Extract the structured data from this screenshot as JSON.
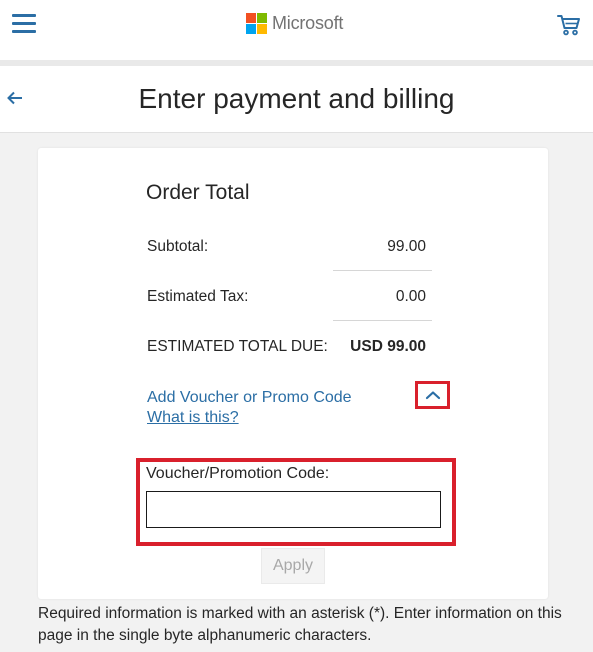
{
  "brand": {
    "name": "Microsoft",
    "logo_colors": [
      "#f25022",
      "#7fba00",
      "#00a4ef",
      "#ffb900"
    ]
  },
  "header": {
    "menu_icon": "hamburger-menu-icon",
    "cart_icon": "shopping-cart-icon"
  },
  "page": {
    "title": "Enter payment and billing",
    "back_icon": "back-arrow-icon"
  },
  "order": {
    "heading": "Order Total",
    "subtotal_label": "Subtotal:",
    "subtotal_value": "99.00",
    "tax_label": "Estimated Tax:",
    "tax_value": "0.00",
    "total_label": "ESTIMATED TOTAL DUE:",
    "total_value": "USD 99.00"
  },
  "voucher": {
    "toggle_label": "Add Voucher or Promo Code",
    "help_link": "What is this?",
    "toggle_icon": "chevron-up-icon",
    "field_label": "Voucher/Promotion Code:",
    "field_value": "",
    "apply_label": "Apply"
  },
  "footnote": "Required information is marked with an asterisk (*). Enter information on this page in the single byte alphanumeric characters.",
  "colors": {
    "accent": "#2b6ea5",
    "highlight": "#d9202c"
  }
}
